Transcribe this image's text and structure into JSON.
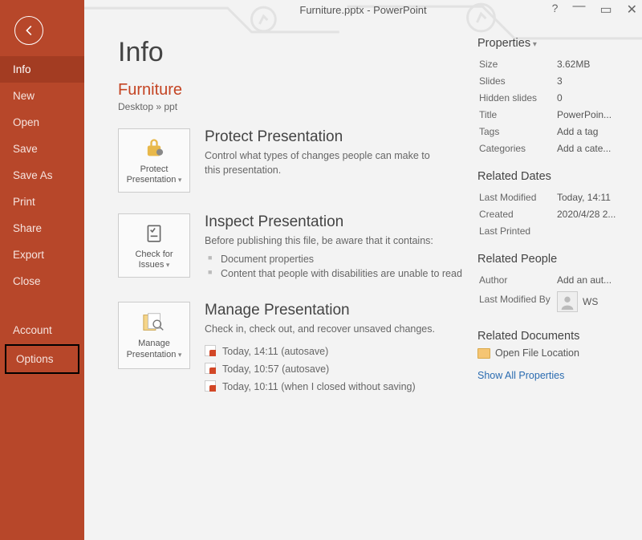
{
  "window": {
    "title": "Furniture.pptx - PowerPoint"
  },
  "sidebar": {
    "items": [
      {
        "label": "Info",
        "selected": true
      },
      {
        "label": "New"
      },
      {
        "label": "Open"
      },
      {
        "label": "Save"
      },
      {
        "label": "Save As"
      },
      {
        "label": "Print"
      },
      {
        "label": "Share"
      },
      {
        "label": "Export"
      },
      {
        "label": "Close"
      }
    ],
    "footer": [
      {
        "label": "Account"
      },
      {
        "label": "Options",
        "highlight": true
      }
    ]
  },
  "page": {
    "heading": "Info",
    "docTitle": "Furniture",
    "path": "Desktop » ppt"
  },
  "protect": {
    "tileLine1": "Protect",
    "tileLine2": "Presentation",
    "heading": "Protect Presentation",
    "desc": "Control what types of changes people can make to this presentation."
  },
  "inspect": {
    "tileLine1": "Check for",
    "tileLine2": "Issues",
    "heading": "Inspect Presentation",
    "desc": "Before publishing this file, be aware that it contains:",
    "items": [
      "Document properties",
      "Content that people with disabilities are unable to read"
    ]
  },
  "manage": {
    "tileLine1": "Manage",
    "tileLine2": "Presentation",
    "heading": "Manage Presentation",
    "desc": "Check in, check out, and recover unsaved changes.",
    "versions": [
      "Today, 14:11 (autosave)",
      "Today, 10:57 (autosave)",
      "Today, 10:11 (when I closed without saving)"
    ]
  },
  "props": {
    "heading": "Properties",
    "rows": {
      "sizeLabel": "Size",
      "sizeVal": "3.62MB",
      "slidesLabel": "Slides",
      "slidesVal": "3",
      "hiddenLabel": "Hidden slides",
      "hiddenVal": "0",
      "titleLabel": "Title",
      "titleVal": "PowerPoin...",
      "tagsLabel": "Tags",
      "tagsVal": "Add a tag",
      "catLabel": "Categories",
      "catVal": "Add a cate..."
    }
  },
  "dates": {
    "heading": "Related Dates",
    "modLabel": "Last Modified",
    "modVal": "Today, 14:11",
    "createdLabel": "Created",
    "createdVal": "2020/4/28 2...",
    "printedLabel": "Last Printed",
    "printedVal": ""
  },
  "people": {
    "heading": "Related People",
    "authorLabel": "Author",
    "authorVal": "Add an aut...",
    "modByLabel": "Last Modified By",
    "modByVal": "WS"
  },
  "docs": {
    "heading": "Related Documents",
    "openLoc": "Open File Location",
    "showAll": "Show All Properties"
  }
}
